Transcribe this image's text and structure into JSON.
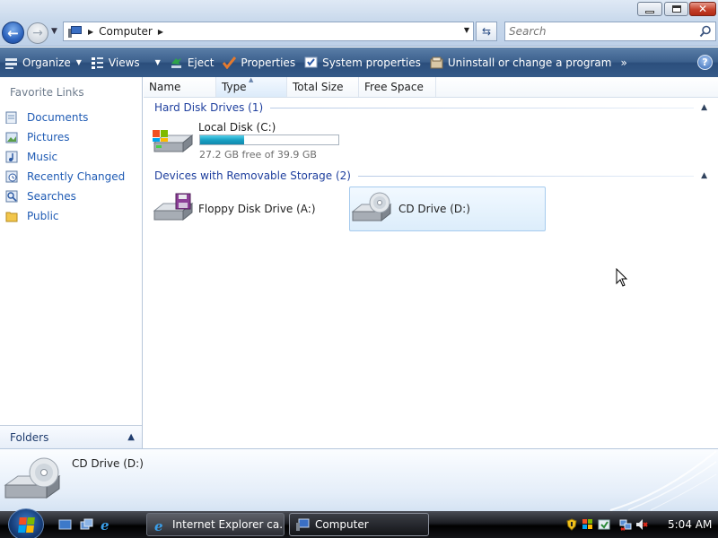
{
  "window": {
    "address": {
      "path": "Computer"
    },
    "search": {
      "placeholder": "Search"
    }
  },
  "toolbar": {
    "organize": "Organize",
    "views": "Views",
    "eject": "Eject",
    "properties": "Properties",
    "system_properties": "System properties",
    "uninstall": "Uninstall or change a program",
    "more": "»"
  },
  "navpane": {
    "favorite_links_title": "Favorite Links",
    "items": [
      {
        "label": "Documents",
        "icon": "documents-icon"
      },
      {
        "label": "Pictures",
        "icon": "pictures-icon"
      },
      {
        "label": "Music",
        "icon": "music-icon"
      },
      {
        "label": "Recently Changed",
        "icon": "recently-changed-icon"
      },
      {
        "label": "Searches",
        "icon": "searches-icon"
      },
      {
        "label": "Public",
        "icon": "public-icon"
      }
    ],
    "folders_label": "Folders"
  },
  "columns": [
    {
      "label": "Name"
    },
    {
      "label": "Type",
      "sorted": true
    },
    {
      "label": "Total Size"
    },
    {
      "label": "Free Space"
    }
  ],
  "groups": {
    "hard_disk": {
      "title": "Hard Disk Drives (1)",
      "items": [
        {
          "name": "Local Disk (C:)",
          "free_text": "27.2 GB free of 39.9 GB",
          "used_fraction": 0.32
        }
      ]
    },
    "removable": {
      "title": "Devices with Removable Storage (2)",
      "items": [
        {
          "name": "Floppy Disk Drive (A:)"
        },
        {
          "name": "CD Drive (D:)",
          "selected": true
        }
      ]
    }
  },
  "details_pane": {
    "name": "CD Drive (D:)"
  },
  "taskbar": {
    "tasks": [
      {
        "label": "Internet Explorer ca..."
      },
      {
        "label": "Computer",
        "active": true
      }
    ],
    "clock": "5:04 AM"
  },
  "colors": {
    "accent": "#1f5bb4",
    "group_header": "#1e3f9e",
    "capacity_fill": "#1aa2c5",
    "command_bar": "#3b5f8c"
  }
}
